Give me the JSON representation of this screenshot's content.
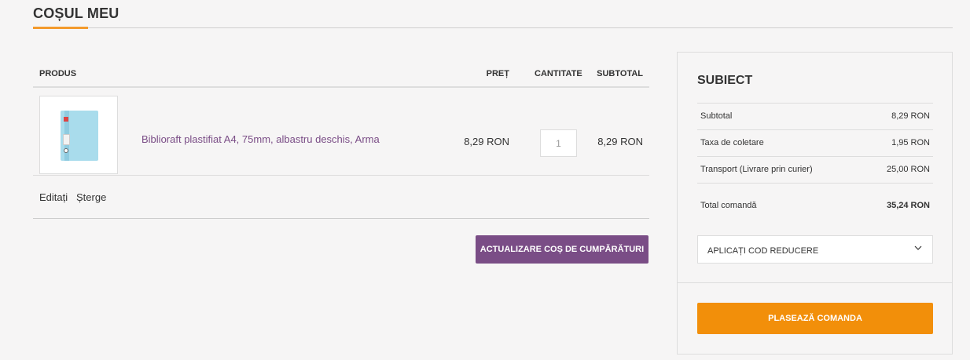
{
  "page": {
    "title": "COȘUL MEU"
  },
  "colors": {
    "accent": "#f39a2c",
    "purple": "#7a4d86",
    "orange": "#f28f0a"
  },
  "cart": {
    "headers": {
      "product": "PRODUS",
      "price": "PREȚ",
      "quantity": "CANTITATE",
      "subtotal": "SUBTOTAL"
    },
    "items": [
      {
        "name": "Biblioraft plastifiat A4, 75mm, albastru deschis, Arma",
        "price": "8,29 RON",
        "quantity": "1",
        "subtotal": "8,29 RON",
        "image_icon": "binder-icon"
      }
    ],
    "actions": {
      "edit": "Editați",
      "delete": "Șterge"
    },
    "update_button": "ACTUALIZARE COȘ DE CUMPĂRĂTURI"
  },
  "summary": {
    "title": "SUBIECT",
    "rows": [
      {
        "label": "Subtotal",
        "value": "8,29 RON"
      },
      {
        "label": "Taxa de coletare",
        "value": "1,95 RON"
      },
      {
        "label": "Transport (Livrare prin curier)",
        "value": "25,00 RON"
      }
    ],
    "total": {
      "label": "Total comandă",
      "value": "35,24 RON"
    },
    "discount_label": "APLICAȚI COD REDUCERE",
    "discount_icon": "chevron-down-icon",
    "checkout_button": "PLASEAZĂ COMANDA"
  }
}
